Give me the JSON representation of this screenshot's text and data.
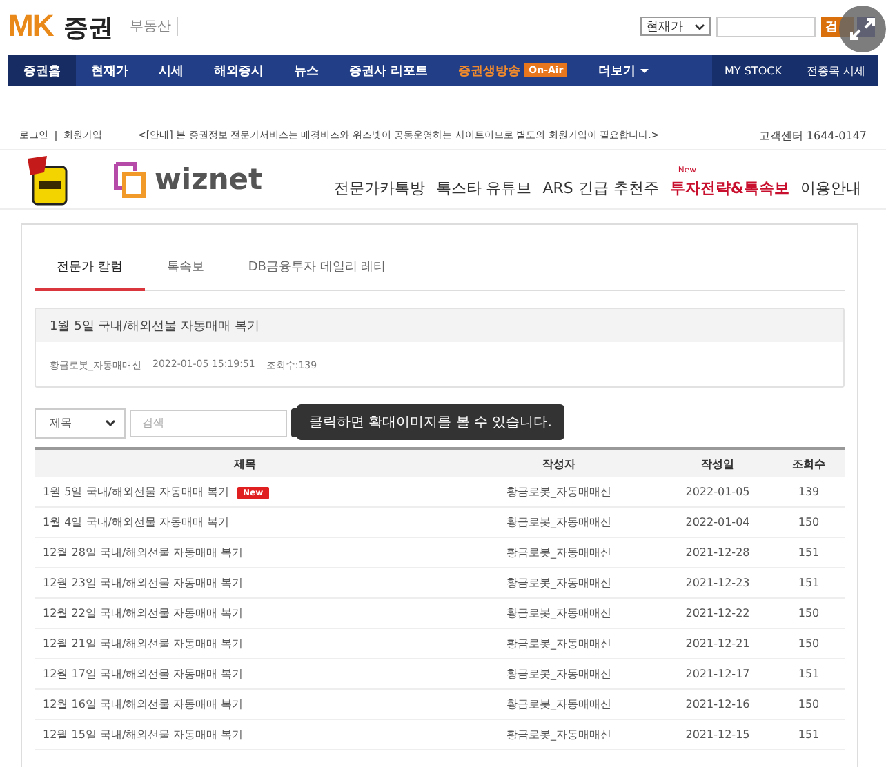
{
  "header": {
    "logo_mark": "MK",
    "logo_text": "증권",
    "sub_link": "부동산",
    "search_select": "현재가",
    "search_button": "검"
  },
  "nav": {
    "items": [
      {
        "label": "증권홈",
        "selected": true,
        "kind": "plain"
      },
      {
        "label": "현재가",
        "selected": false,
        "kind": "plain"
      },
      {
        "label": "시세",
        "selected": false,
        "kind": "plain"
      },
      {
        "label": "해외증시",
        "selected": false,
        "kind": "plain"
      },
      {
        "label": "뉴스",
        "selected": false,
        "kind": "plain"
      },
      {
        "label": "증권사 리포트",
        "selected": false,
        "kind": "plain"
      },
      {
        "label": "증권생방송",
        "selected": false,
        "kind": "live",
        "badge": "On-Air"
      },
      {
        "label": "더보기",
        "selected": false,
        "kind": "more"
      }
    ],
    "right_items": [
      "MY STOCK",
      "전종목 시세"
    ]
  },
  "notice_bar": {
    "login": "로그인",
    "join": "회원가입",
    "notice": "<[안내] 본 증권정보 전문가서비스는 매경비즈와 위즈넷이 공동운영하는 사이트이므로 별도의 회원가입이 필요합니다.>",
    "support": "고객센터 1644-0147"
  },
  "site": {
    "logo_text": "wiznet",
    "menu": [
      {
        "label": "전문가카톡방",
        "kind": "plain"
      },
      {
        "label": "톡스타 유튜브",
        "kind": "plain"
      },
      {
        "label": "ARS 긴급 추천주",
        "kind": "plain"
      },
      {
        "label": "투자전략&톡속보",
        "kind": "new",
        "badge": "New"
      },
      {
        "label": "이용안내",
        "kind": "plain"
      }
    ]
  },
  "tabs": [
    {
      "label": "전문가 칼럼",
      "selected": true
    },
    {
      "label": "톡속보",
      "selected": false
    },
    {
      "label": "DB금융투자 데일리 레터",
      "selected": false
    }
  ],
  "featured": {
    "title": "1월 5일 국내/해외선물 자동매매 복기",
    "author": "황금로봇_자동매매신",
    "datetime": "2022-01-05 15:19:51",
    "views": "조회수:139"
  },
  "search": {
    "field": "제목",
    "placeholder": "검색"
  },
  "tooltip": "클릭하면 확대이미지를 볼 수 있습니다.",
  "table": {
    "columns": [
      "제목",
      "작성자",
      "작성일",
      "조회수"
    ],
    "rows": [
      {
        "title": "1월 5일 국내/해외선물 자동매매 복기",
        "badge": "New",
        "author": "황금로봇_자동매매신",
        "date": "2022-01-05",
        "views": "139"
      },
      {
        "title": "1월 4일 국내/해외선물 자동매매 복기",
        "author": "황금로봇_자동매매신",
        "date": "2022-01-04",
        "views": "150"
      },
      {
        "title": "12월 28일 국내/해외선물 자동매매 복기",
        "author": "황금로봇_자동매매신",
        "date": "2021-12-28",
        "views": "151"
      },
      {
        "title": "12월 23일 국내/해외선물 자동매매 복기",
        "author": "황금로봇_자동매매신",
        "date": "2021-12-23",
        "views": "151"
      },
      {
        "title": "12월 22일 국내/해외선물 자동매매 복기",
        "author": "황금로봇_자동매매신",
        "date": "2021-12-22",
        "views": "150"
      },
      {
        "title": "12월 21일 국내/해외선물 자동매매 복기",
        "author": "황금로봇_자동매매신",
        "date": "2021-12-21",
        "views": "150"
      },
      {
        "title": "12월 17일 국내/해외선물 자동매매 복기",
        "author": "황금로봇_자동매매신",
        "date": "2021-12-17",
        "views": "151"
      },
      {
        "title": "12월 16일 국내/해외선물 자동매매 복기",
        "author": "황금로봇_자동매매신",
        "date": "2021-12-16",
        "views": "150"
      },
      {
        "title": "12월 15일 국내/해외선물 자동매매 복기",
        "author": "황금로봇_자동매매신",
        "date": "2021-12-15",
        "views": "151"
      }
    ]
  }
}
